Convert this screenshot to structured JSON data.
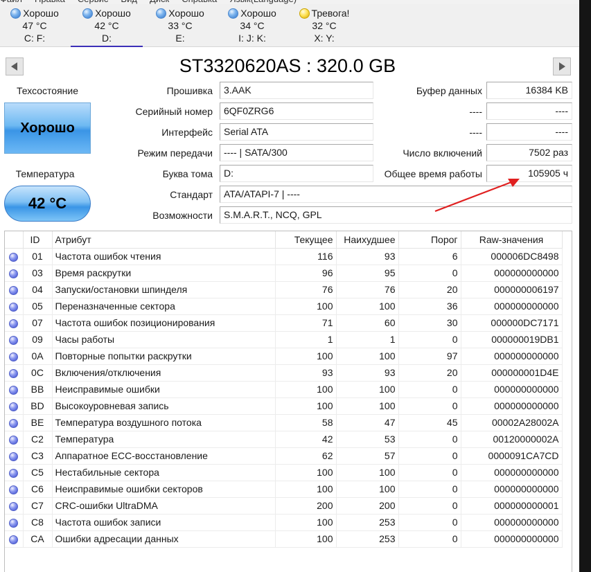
{
  "menubar": {
    "items": [
      "Файл",
      "Правка",
      "Сервис",
      "Вид",
      "Диск",
      "Справка",
      "Язык(Language)"
    ]
  },
  "disks": [
    {
      "status": "Хорошо",
      "temp": "47 °C",
      "letter": "C: F:",
      "dot": "blue",
      "selected": false
    },
    {
      "status": "Хорошо",
      "temp": "42 °C",
      "letter": "D:",
      "dot": "blue",
      "selected": true
    },
    {
      "status": "Хорошо",
      "temp": "33 °C",
      "letter": "E:",
      "dot": "blue",
      "selected": false
    },
    {
      "status": "Хорошо",
      "temp": "34 °C",
      "letter": "I: J: K:",
      "dot": "blue",
      "selected": false
    },
    {
      "status": "Тревога!",
      "temp": "32 °C",
      "letter": "X: Y:",
      "dot": "yellow",
      "selected": false
    }
  ],
  "title": "ST3320620AS : 320.0 GB",
  "left": {
    "health_label": "Техсостояние",
    "health_value": "Хорошо",
    "temp_label": "Температура",
    "temp_value": "42 °C"
  },
  "info": {
    "firmware": {
      "label": "Прошивка",
      "value": "3.AAK"
    },
    "serial": {
      "label": "Серийный номер",
      "value": "6QF0ZRG6"
    },
    "interface": {
      "label": "Интерфейс",
      "value": "Serial ATA"
    },
    "transfer": {
      "label": "Режим передачи",
      "value": "---- | SATA/300"
    },
    "volume": {
      "label": "Буква тома",
      "value": "D:"
    },
    "standard": {
      "label": "Стандарт",
      "value": "ATA/ATAPI-7 | ----"
    },
    "features": {
      "label": "Возможности",
      "value": "S.M.A.R.T., NCQ, GPL"
    },
    "buffer": {
      "label": "Буфер данных",
      "value": "16384 KB"
    },
    "blank1": {
      "label": "----",
      "value": "----"
    },
    "blank2": {
      "label": "----",
      "value": "----"
    },
    "power_count": {
      "label": "Число включений",
      "value": "7502 раз"
    },
    "power_hours": {
      "label": "Общее время работы",
      "value": "105905 ч"
    }
  },
  "colors": {
    "arrow": "#e02020",
    "selected_underline": "#3b2fb8",
    "health_blue": "#3a95e6"
  },
  "table": {
    "headers": {
      "id": "ID",
      "attr": "Атрибут",
      "cur": "Текущее",
      "worst": "Наихудшее",
      "thr": "Порог",
      "raw": "Raw-значения"
    },
    "rows": [
      {
        "id": "01",
        "attr": "Частота ошибок чтения",
        "cur": "116",
        "worst": "93",
        "thr": "6",
        "raw": "000006DC8498"
      },
      {
        "id": "03",
        "attr": "Время раскрутки",
        "cur": "96",
        "worst": "95",
        "thr": "0",
        "raw": "000000000000"
      },
      {
        "id": "04",
        "attr": "Запуски/остановки шпинделя",
        "cur": "76",
        "worst": "76",
        "thr": "20",
        "raw": "000000006197"
      },
      {
        "id": "05",
        "attr": "Переназначенные сектора",
        "cur": "100",
        "worst": "100",
        "thr": "36",
        "raw": "000000000000"
      },
      {
        "id": "07",
        "attr": "Частота ошибок позиционирования",
        "cur": "71",
        "worst": "60",
        "thr": "30",
        "raw": "000000DC7171"
      },
      {
        "id": "09",
        "attr": "Часы работы",
        "cur": "1",
        "worst": "1",
        "thr": "0",
        "raw": "000000019DB1"
      },
      {
        "id": "0A",
        "attr": "Повторные попытки раскрутки",
        "cur": "100",
        "worst": "100",
        "thr": "97",
        "raw": "000000000000"
      },
      {
        "id": "0C",
        "attr": "Включения/отключения",
        "cur": "93",
        "worst": "93",
        "thr": "20",
        "raw": "000000001D4E"
      },
      {
        "id": "BB",
        "attr": "Неисправимые ошибки",
        "cur": "100",
        "worst": "100",
        "thr": "0",
        "raw": "000000000000"
      },
      {
        "id": "BD",
        "attr": "Высокоуровневая запись",
        "cur": "100",
        "worst": "100",
        "thr": "0",
        "raw": "000000000000"
      },
      {
        "id": "BE",
        "attr": "Температура воздушного потока",
        "cur": "58",
        "worst": "47",
        "thr": "45",
        "raw": "00002A28002A"
      },
      {
        "id": "C2",
        "attr": "Температура",
        "cur": "42",
        "worst": "53",
        "thr": "0",
        "raw": "00120000002A"
      },
      {
        "id": "C3",
        "attr": "Аппаратное ECC-восстановление",
        "cur": "62",
        "worst": "57",
        "thr": "0",
        "raw": "0000091CA7CD"
      },
      {
        "id": "C5",
        "attr": "Нестабильные сектора",
        "cur": "100",
        "worst": "100",
        "thr": "0",
        "raw": "000000000000"
      },
      {
        "id": "C6",
        "attr": "Неисправимые ошибки секторов",
        "cur": "100",
        "worst": "100",
        "thr": "0",
        "raw": "000000000000"
      },
      {
        "id": "C7",
        "attr": "CRC-ошибки UltraDMA",
        "cur": "200",
        "worst": "200",
        "thr": "0",
        "raw": "000000000001"
      },
      {
        "id": "C8",
        "attr": "Частота ошибок записи",
        "cur": "100",
        "worst": "253",
        "thr": "0",
        "raw": "000000000000"
      },
      {
        "id": "CA",
        "attr": "Ошибки адресации данных",
        "cur": "100",
        "worst": "253",
        "thr": "0",
        "raw": "000000000000"
      }
    ]
  }
}
